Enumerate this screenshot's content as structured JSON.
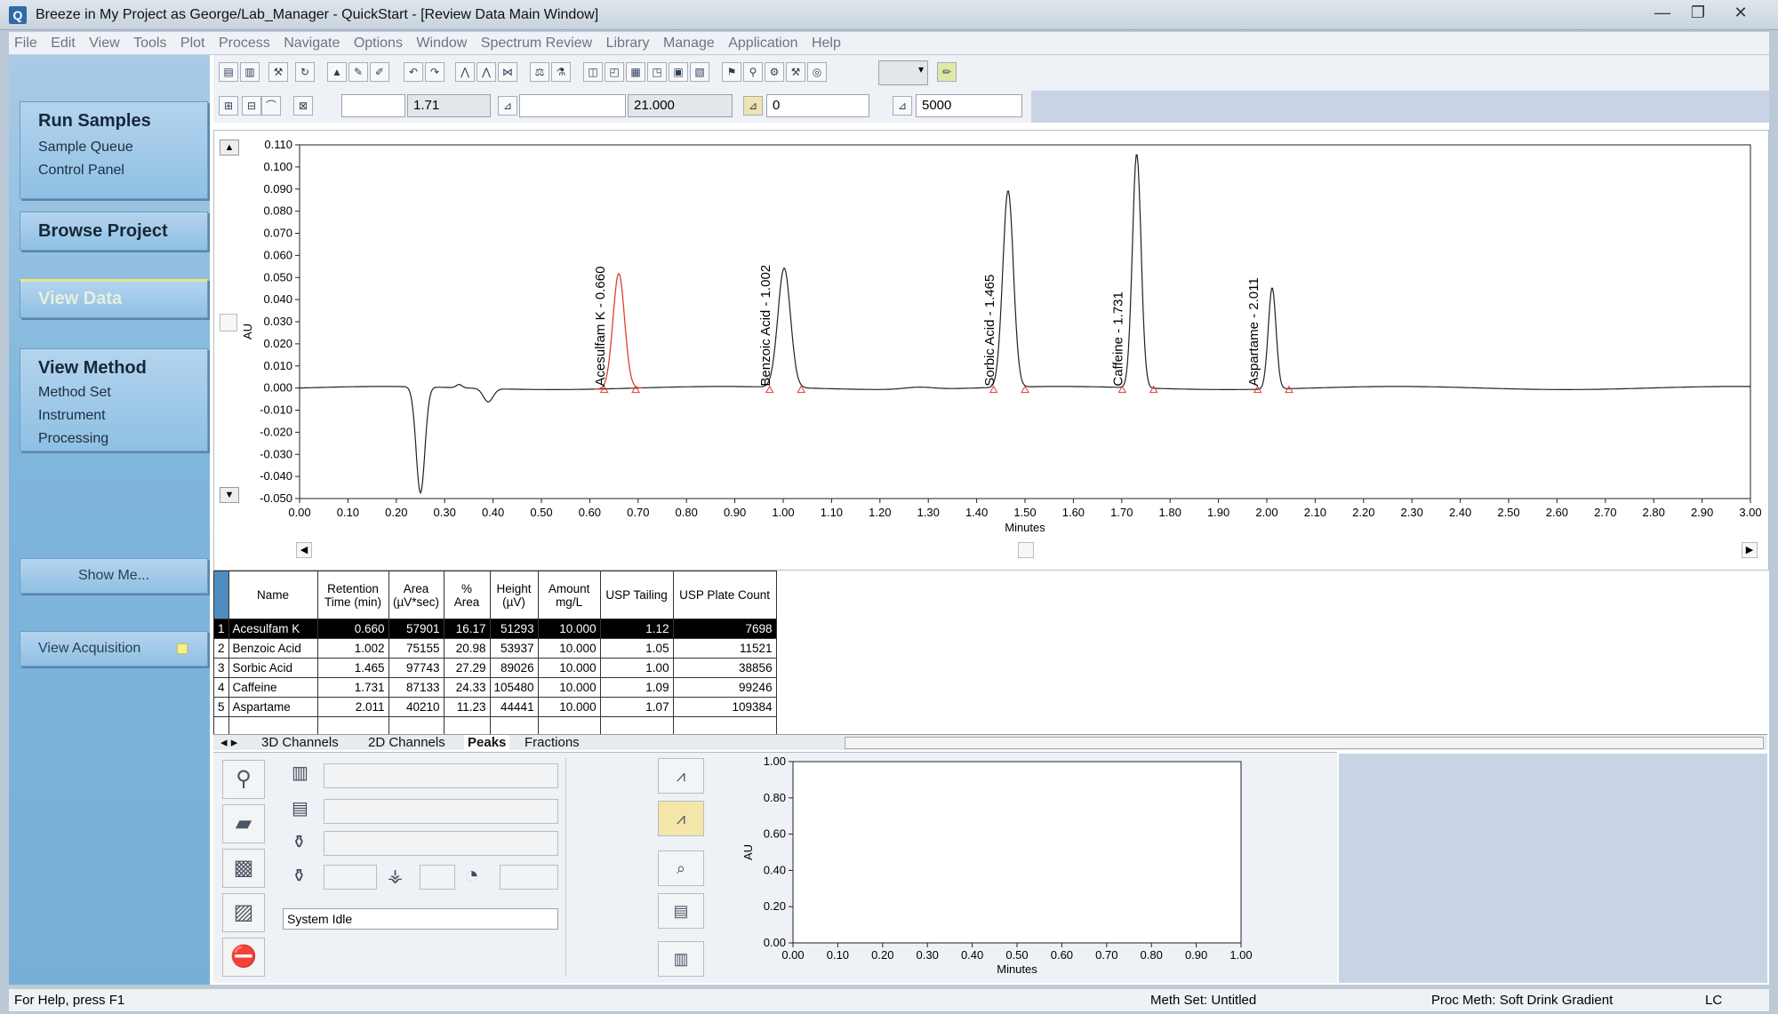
{
  "window": {
    "icon_letter": "Q",
    "title": "Breeze in My Project as George/Lab_Manager - QuickStart - [Review Data Main Window]",
    "controls": [
      "—",
      "❐",
      "✕"
    ]
  },
  "menu": [
    "File",
    "Edit",
    "View",
    "Tools",
    "Plot",
    "Process",
    "Navigate",
    "Options",
    "Window",
    "Spectrum Review",
    "Library",
    "Manage",
    "Application",
    "Help"
  ],
  "nav": {
    "run_samples": {
      "title": "Run Samples",
      "items": [
        "Sample Queue",
        "Control Panel"
      ]
    },
    "browse_project": "Browse Project",
    "view_data": "View Data",
    "view_method": {
      "title": "View Method",
      "items": [
        "Method Set",
        "Instrument",
        "Processing"
      ]
    },
    "show_me": "Show Me...",
    "view_acquisition": "View Acquisition"
  },
  "toolbar": {
    "field1": "",
    "field2": "1.71",
    "field3": "",
    "field4": "21.000",
    "field5": "0",
    "field6": "5000"
  },
  "chart_data": [
    {
      "type": "line",
      "title": "",
      "xlabel": "Minutes",
      "ylabel": "AU",
      "xlim": [
        0.0,
        3.0
      ],
      "ylim": [
        -0.05,
        0.11
      ],
      "x_ticks": [
        "0.00",
        "0.10",
        "0.20",
        "0.30",
        "0.40",
        "0.50",
        "0.60",
        "0.70",
        "0.80",
        "0.90",
        "1.00",
        "1.10",
        "1.20",
        "1.30",
        "1.40",
        "1.50",
        "1.60",
        "1.70",
        "1.80",
        "1.90",
        "2.00",
        "2.10",
        "2.20",
        "2.30",
        "2.40",
        "2.50",
        "2.60",
        "2.70",
        "2.80",
        "2.90",
        "3.00"
      ],
      "y_ticks": [
        "0.110",
        "0.100",
        "0.090",
        "0.080",
        "0.070",
        "0.060",
        "0.050",
        "0.040",
        "0.030",
        "0.020",
        "0.010",
        "0.000",
        "-0.010",
        "-0.020",
        "-0.030",
        "-0.040",
        "-0.050"
      ],
      "grid": false,
      "peaks": [
        {
          "label": "Acesulfam K - 0.660",
          "rt": 0.66,
          "height": 0.052,
          "integrated": true
        },
        {
          "label": "Benzoic Acid - 1.002",
          "rt": 1.002,
          "height": 0.054,
          "integrated": false
        },
        {
          "label": "Sorbic Acid - 1.465",
          "rt": 1.465,
          "height": 0.089,
          "integrated": false
        },
        {
          "label": "Caffeine - 1.731",
          "rt": 1.731,
          "height": 0.106,
          "integrated": false
        },
        {
          "label": "Aspartame - 2.011",
          "rt": 2.011,
          "height": 0.046,
          "integrated": false
        }
      ],
      "dip": {
        "rt": 0.25,
        "depth": -0.048
      }
    },
    {
      "type": "line",
      "title": "",
      "xlabel": "Minutes",
      "ylabel": "AU",
      "xlim": [
        0.0,
        1.0
      ],
      "ylim": [
        0.0,
        1.0
      ],
      "x_ticks": [
        "0.00",
        "0.10",
        "0.20",
        "0.30",
        "0.40",
        "0.50",
        "0.60",
        "0.70",
        "0.80",
        "0.90",
        "1.00"
      ],
      "y_ticks": [
        "1.00",
        "0.80",
        "0.60",
        "0.40",
        "0.20",
        "0.00"
      ],
      "series": []
    }
  ],
  "peak_table": {
    "headers": [
      "Name",
      "Retention Time (min)",
      "Area (µV*sec)",
      "% Area",
      "Height (µV)",
      "Amount mg/L",
      "USP Tailing",
      "USP Plate Count"
    ],
    "rows": [
      [
        "1",
        "Acesulfam K",
        "0.660",
        "57901",
        "16.17",
        "51293",
        "10.000",
        "1.12",
        "7698"
      ],
      [
        "2",
        "Benzoic Acid",
        "1.002",
        "75155",
        "20.98",
        "53937",
        "10.000",
        "1.05",
        "11521"
      ],
      [
        "3",
        "Sorbic Acid",
        "1.465",
        "97743",
        "27.29",
        "89026",
        "10.000",
        "1.00",
        "38856"
      ],
      [
        "4",
        "Caffeine",
        "1.731",
        "87133",
        "24.33",
        "105480",
        "10.000",
        "1.09",
        "99246"
      ],
      [
        "5",
        "Aspartame",
        "2.011",
        "40210",
        "11.23",
        "44441",
        "10.000",
        "1.07",
        "109384"
      ]
    ]
  },
  "tabs": [
    "3D Channels",
    "2D Channels",
    "Peaks",
    "Fractions"
  ],
  "system_status": "System Idle",
  "statusbar": {
    "help": "For Help, press F1",
    "meth_set": "Meth Set: Untitled",
    "proc_meth": "Proc Meth: Soft Drink Gradient",
    "mode": "LC"
  }
}
